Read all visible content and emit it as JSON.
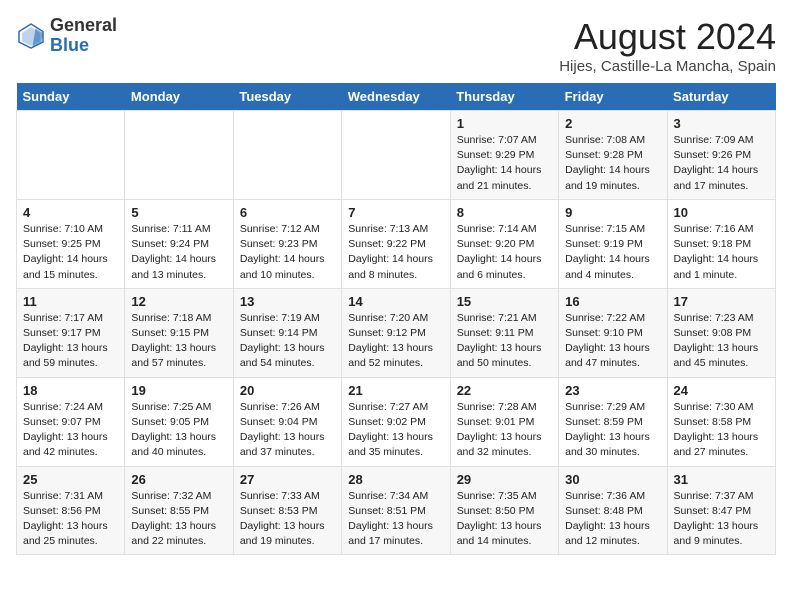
{
  "header": {
    "logo_general": "General",
    "logo_blue": "Blue",
    "month_year": "August 2024",
    "location": "Hijes, Castille-La Mancha, Spain"
  },
  "weekdays": [
    "Sunday",
    "Monday",
    "Tuesday",
    "Wednesday",
    "Thursday",
    "Friday",
    "Saturday"
  ],
  "weeks": [
    [
      {
        "day": "",
        "info": ""
      },
      {
        "day": "",
        "info": ""
      },
      {
        "day": "",
        "info": ""
      },
      {
        "day": "",
        "info": ""
      },
      {
        "day": "1",
        "info": "Sunrise: 7:07 AM\nSunset: 9:29 PM\nDaylight: 14 hours\nand 21 minutes."
      },
      {
        "day": "2",
        "info": "Sunrise: 7:08 AM\nSunset: 9:28 PM\nDaylight: 14 hours\nand 19 minutes."
      },
      {
        "day": "3",
        "info": "Sunrise: 7:09 AM\nSunset: 9:26 PM\nDaylight: 14 hours\nand 17 minutes."
      }
    ],
    [
      {
        "day": "4",
        "info": "Sunrise: 7:10 AM\nSunset: 9:25 PM\nDaylight: 14 hours\nand 15 minutes."
      },
      {
        "day": "5",
        "info": "Sunrise: 7:11 AM\nSunset: 9:24 PM\nDaylight: 14 hours\nand 13 minutes."
      },
      {
        "day": "6",
        "info": "Sunrise: 7:12 AM\nSunset: 9:23 PM\nDaylight: 14 hours\nand 10 minutes."
      },
      {
        "day": "7",
        "info": "Sunrise: 7:13 AM\nSunset: 9:22 PM\nDaylight: 14 hours\nand 8 minutes."
      },
      {
        "day": "8",
        "info": "Sunrise: 7:14 AM\nSunset: 9:20 PM\nDaylight: 14 hours\nand 6 minutes."
      },
      {
        "day": "9",
        "info": "Sunrise: 7:15 AM\nSunset: 9:19 PM\nDaylight: 14 hours\nand 4 minutes."
      },
      {
        "day": "10",
        "info": "Sunrise: 7:16 AM\nSunset: 9:18 PM\nDaylight: 14 hours\nand 1 minute."
      }
    ],
    [
      {
        "day": "11",
        "info": "Sunrise: 7:17 AM\nSunset: 9:17 PM\nDaylight: 13 hours\nand 59 minutes."
      },
      {
        "day": "12",
        "info": "Sunrise: 7:18 AM\nSunset: 9:15 PM\nDaylight: 13 hours\nand 57 minutes."
      },
      {
        "day": "13",
        "info": "Sunrise: 7:19 AM\nSunset: 9:14 PM\nDaylight: 13 hours\nand 54 minutes."
      },
      {
        "day": "14",
        "info": "Sunrise: 7:20 AM\nSunset: 9:12 PM\nDaylight: 13 hours\nand 52 minutes."
      },
      {
        "day": "15",
        "info": "Sunrise: 7:21 AM\nSunset: 9:11 PM\nDaylight: 13 hours\nand 50 minutes."
      },
      {
        "day": "16",
        "info": "Sunrise: 7:22 AM\nSunset: 9:10 PM\nDaylight: 13 hours\nand 47 minutes."
      },
      {
        "day": "17",
        "info": "Sunrise: 7:23 AM\nSunset: 9:08 PM\nDaylight: 13 hours\nand 45 minutes."
      }
    ],
    [
      {
        "day": "18",
        "info": "Sunrise: 7:24 AM\nSunset: 9:07 PM\nDaylight: 13 hours\nand 42 minutes."
      },
      {
        "day": "19",
        "info": "Sunrise: 7:25 AM\nSunset: 9:05 PM\nDaylight: 13 hours\nand 40 minutes."
      },
      {
        "day": "20",
        "info": "Sunrise: 7:26 AM\nSunset: 9:04 PM\nDaylight: 13 hours\nand 37 minutes."
      },
      {
        "day": "21",
        "info": "Sunrise: 7:27 AM\nSunset: 9:02 PM\nDaylight: 13 hours\nand 35 minutes."
      },
      {
        "day": "22",
        "info": "Sunrise: 7:28 AM\nSunset: 9:01 PM\nDaylight: 13 hours\nand 32 minutes."
      },
      {
        "day": "23",
        "info": "Sunrise: 7:29 AM\nSunset: 8:59 PM\nDaylight: 13 hours\nand 30 minutes."
      },
      {
        "day": "24",
        "info": "Sunrise: 7:30 AM\nSunset: 8:58 PM\nDaylight: 13 hours\nand 27 minutes."
      }
    ],
    [
      {
        "day": "25",
        "info": "Sunrise: 7:31 AM\nSunset: 8:56 PM\nDaylight: 13 hours\nand 25 minutes."
      },
      {
        "day": "26",
        "info": "Sunrise: 7:32 AM\nSunset: 8:55 PM\nDaylight: 13 hours\nand 22 minutes."
      },
      {
        "day": "27",
        "info": "Sunrise: 7:33 AM\nSunset: 8:53 PM\nDaylight: 13 hours\nand 19 minutes."
      },
      {
        "day": "28",
        "info": "Sunrise: 7:34 AM\nSunset: 8:51 PM\nDaylight: 13 hours\nand 17 minutes."
      },
      {
        "day": "29",
        "info": "Sunrise: 7:35 AM\nSunset: 8:50 PM\nDaylight: 13 hours\nand 14 minutes."
      },
      {
        "day": "30",
        "info": "Sunrise: 7:36 AM\nSunset: 8:48 PM\nDaylight: 13 hours\nand 12 minutes."
      },
      {
        "day": "31",
        "info": "Sunrise: 7:37 AM\nSunset: 8:47 PM\nDaylight: 13 hours\nand 9 minutes."
      }
    ]
  ]
}
